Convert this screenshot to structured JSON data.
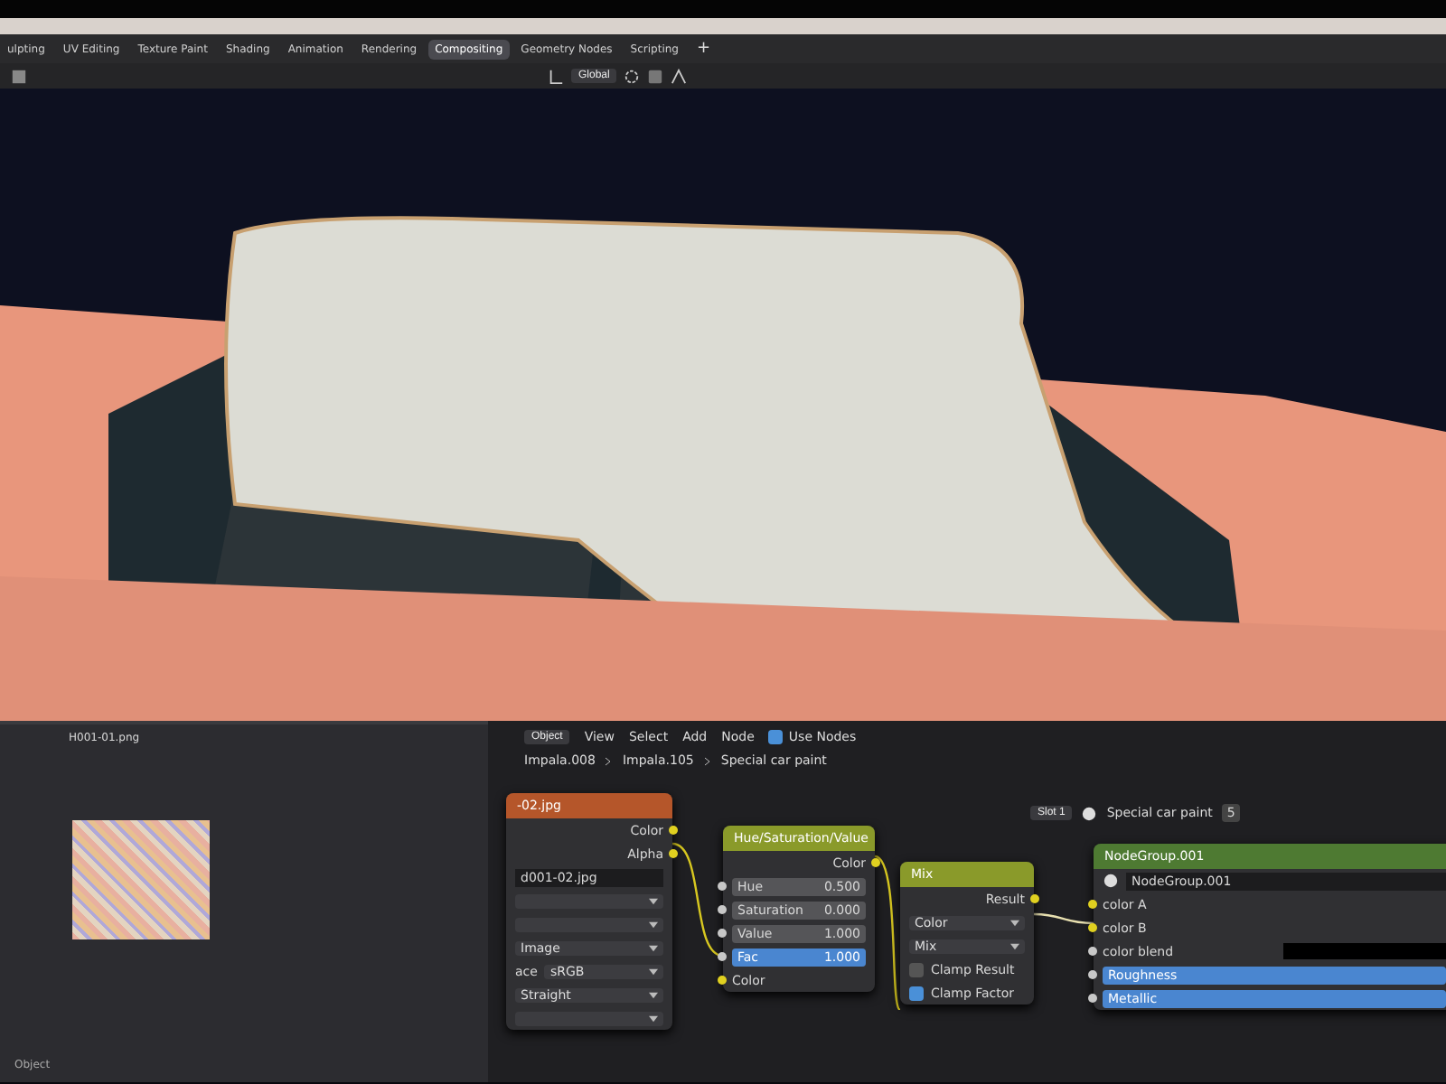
{
  "workspace_tabs": [
    {
      "label": "ulpting",
      "selected": false
    },
    {
      "label": "UV Editing",
      "selected": false
    },
    {
      "label": "Texture Paint",
      "selected": false
    },
    {
      "label": "Shading",
      "selected": false
    },
    {
      "label": "Animation",
      "selected": false
    },
    {
      "label": "Rendering",
      "selected": false
    },
    {
      "label": "Compositing",
      "selected": true
    },
    {
      "label": "Geometry Nodes",
      "selected": false
    },
    {
      "label": "Scripting",
      "selected": false
    }
  ],
  "add_tab": "+",
  "viewport_header": {
    "transform_orientation": "Global"
  },
  "image_editor": {
    "image_name": "H001-01.png",
    "footer_label": "Object"
  },
  "node_editor": {
    "header": {
      "mode": "Object",
      "menus": [
        "View",
        "Select",
        "Add",
        "Node"
      ],
      "use_nodes": {
        "label": "Use Nodes",
        "checked": true
      }
    },
    "breadcrumbs": [
      "Impala.008",
      "Impala.105",
      "Special car paint"
    ],
    "material_slot": {
      "slot": "Slot 1",
      "material": "Special car paint",
      "users": "5"
    },
    "nodes": [
      {
        "kind": "image",
        "title": "-02.jpg",
        "color": "#b5562a",
        "rows": [
          {
            "kind": "output",
            "label": "Color"
          },
          {
            "kind": "output",
            "label": "Alpha"
          },
          {
            "kind": "file",
            "value": "d001-02.jpg"
          },
          {
            "kind": "dropdown"
          },
          {
            "kind": "dropdown"
          },
          {
            "kind": "dropdown",
            "value": "Image"
          },
          {
            "kind": "dropdown",
            "label": "ace",
            "value": "sRGB"
          },
          {
            "kind": "dropdown",
            "value": "Straight"
          },
          {
            "kind": "dropdown"
          }
        ]
      },
      {
        "kind": "hsv",
        "title": "Hue/Saturation/Value",
        "color": "#8a9a2a",
        "rows": [
          {
            "kind": "output",
            "label": "Color"
          },
          {
            "kind": "field",
            "label": "Hue",
            "value": "0.500"
          },
          {
            "kind": "field",
            "label": "Saturation",
            "value": "0.000"
          },
          {
            "kind": "field",
            "label": "Value",
            "value": "1.000"
          },
          {
            "kind": "slider",
            "label": "Fac",
            "value": "1.000",
            "level": 1
          },
          {
            "kind": "input",
            "label": "Color"
          }
        ]
      },
      {
        "kind": "mix",
        "title": "Mix",
        "color": "#8a9a2a",
        "rows": [
          {
            "kind": "output",
            "label": "Result"
          },
          {
            "kind": "dropdown",
            "value": "Color"
          },
          {
            "kind": "dropdown",
            "value": "Mix"
          },
          {
            "kind": "checkbox",
            "label": "Clamp Result",
            "checked": false
          },
          {
            "kind": "checkbox",
            "label": "Clamp Factor",
            "checked": true
          }
        ]
      },
      {
        "kind": "group",
        "title": "NodeGroup.001",
        "color": "#4e7a32",
        "rows": [
          {
            "kind": "datablock",
            "value": "NodeGroup.001"
          },
          {
            "kind": "input",
            "label": "color A"
          },
          {
            "kind": "input",
            "label": "color B"
          },
          {
            "kind": "swatch",
            "label": "color blend"
          },
          {
            "kind": "slider",
            "label": "Roughness",
            "level": 1
          },
          {
            "kind": "slider",
            "label": "Metallic",
            "level": 1
          }
        ]
      }
    ]
  }
}
